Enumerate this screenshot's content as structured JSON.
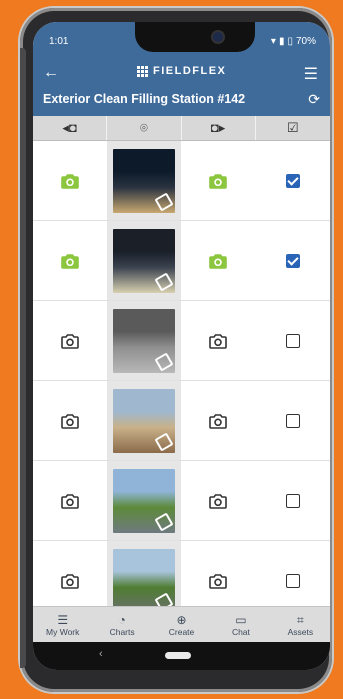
{
  "status": {
    "time": "1:01",
    "battery": "70%"
  },
  "header": {
    "logo_text": "FIELDFLEX",
    "title": "Exterior Clean Filling Station #142"
  },
  "columns": [
    "before-camera-icon",
    "location-pin-icon",
    "after-camera-icon",
    "checkbox-icon"
  ],
  "rows": [
    {
      "before_done": true,
      "after_done": true,
      "checked": true,
      "overlay": "paint-roller-icon"
    },
    {
      "before_done": true,
      "after_done": true,
      "checked": true,
      "overlay": "spray-icon"
    },
    {
      "before_done": false,
      "after_done": false,
      "checked": false,
      "overlay": "mop-icon"
    },
    {
      "before_done": false,
      "after_done": false,
      "checked": false,
      "overlay": "broom-icon"
    },
    {
      "before_done": false,
      "after_done": false,
      "checked": false,
      "overlay": "rake-icon"
    },
    {
      "before_done": false,
      "after_done": false,
      "checked": false,
      "overlay": "lawnmower-icon"
    }
  ],
  "tabs": [
    {
      "label": "My Work",
      "icon": "list-icon"
    },
    {
      "label": "Charts",
      "icon": "pie-chart-icon"
    },
    {
      "label": "Create",
      "icon": "plus-circle-icon"
    },
    {
      "label": "Chat",
      "icon": "chat-icon"
    },
    {
      "label": "Assets",
      "icon": "qr-scan-icon"
    }
  ],
  "colors": {
    "brand": "#3f6b9b",
    "done_green": "#8cc63f",
    "check_blue": "#2a64b6",
    "background": "#ef7a1f"
  }
}
